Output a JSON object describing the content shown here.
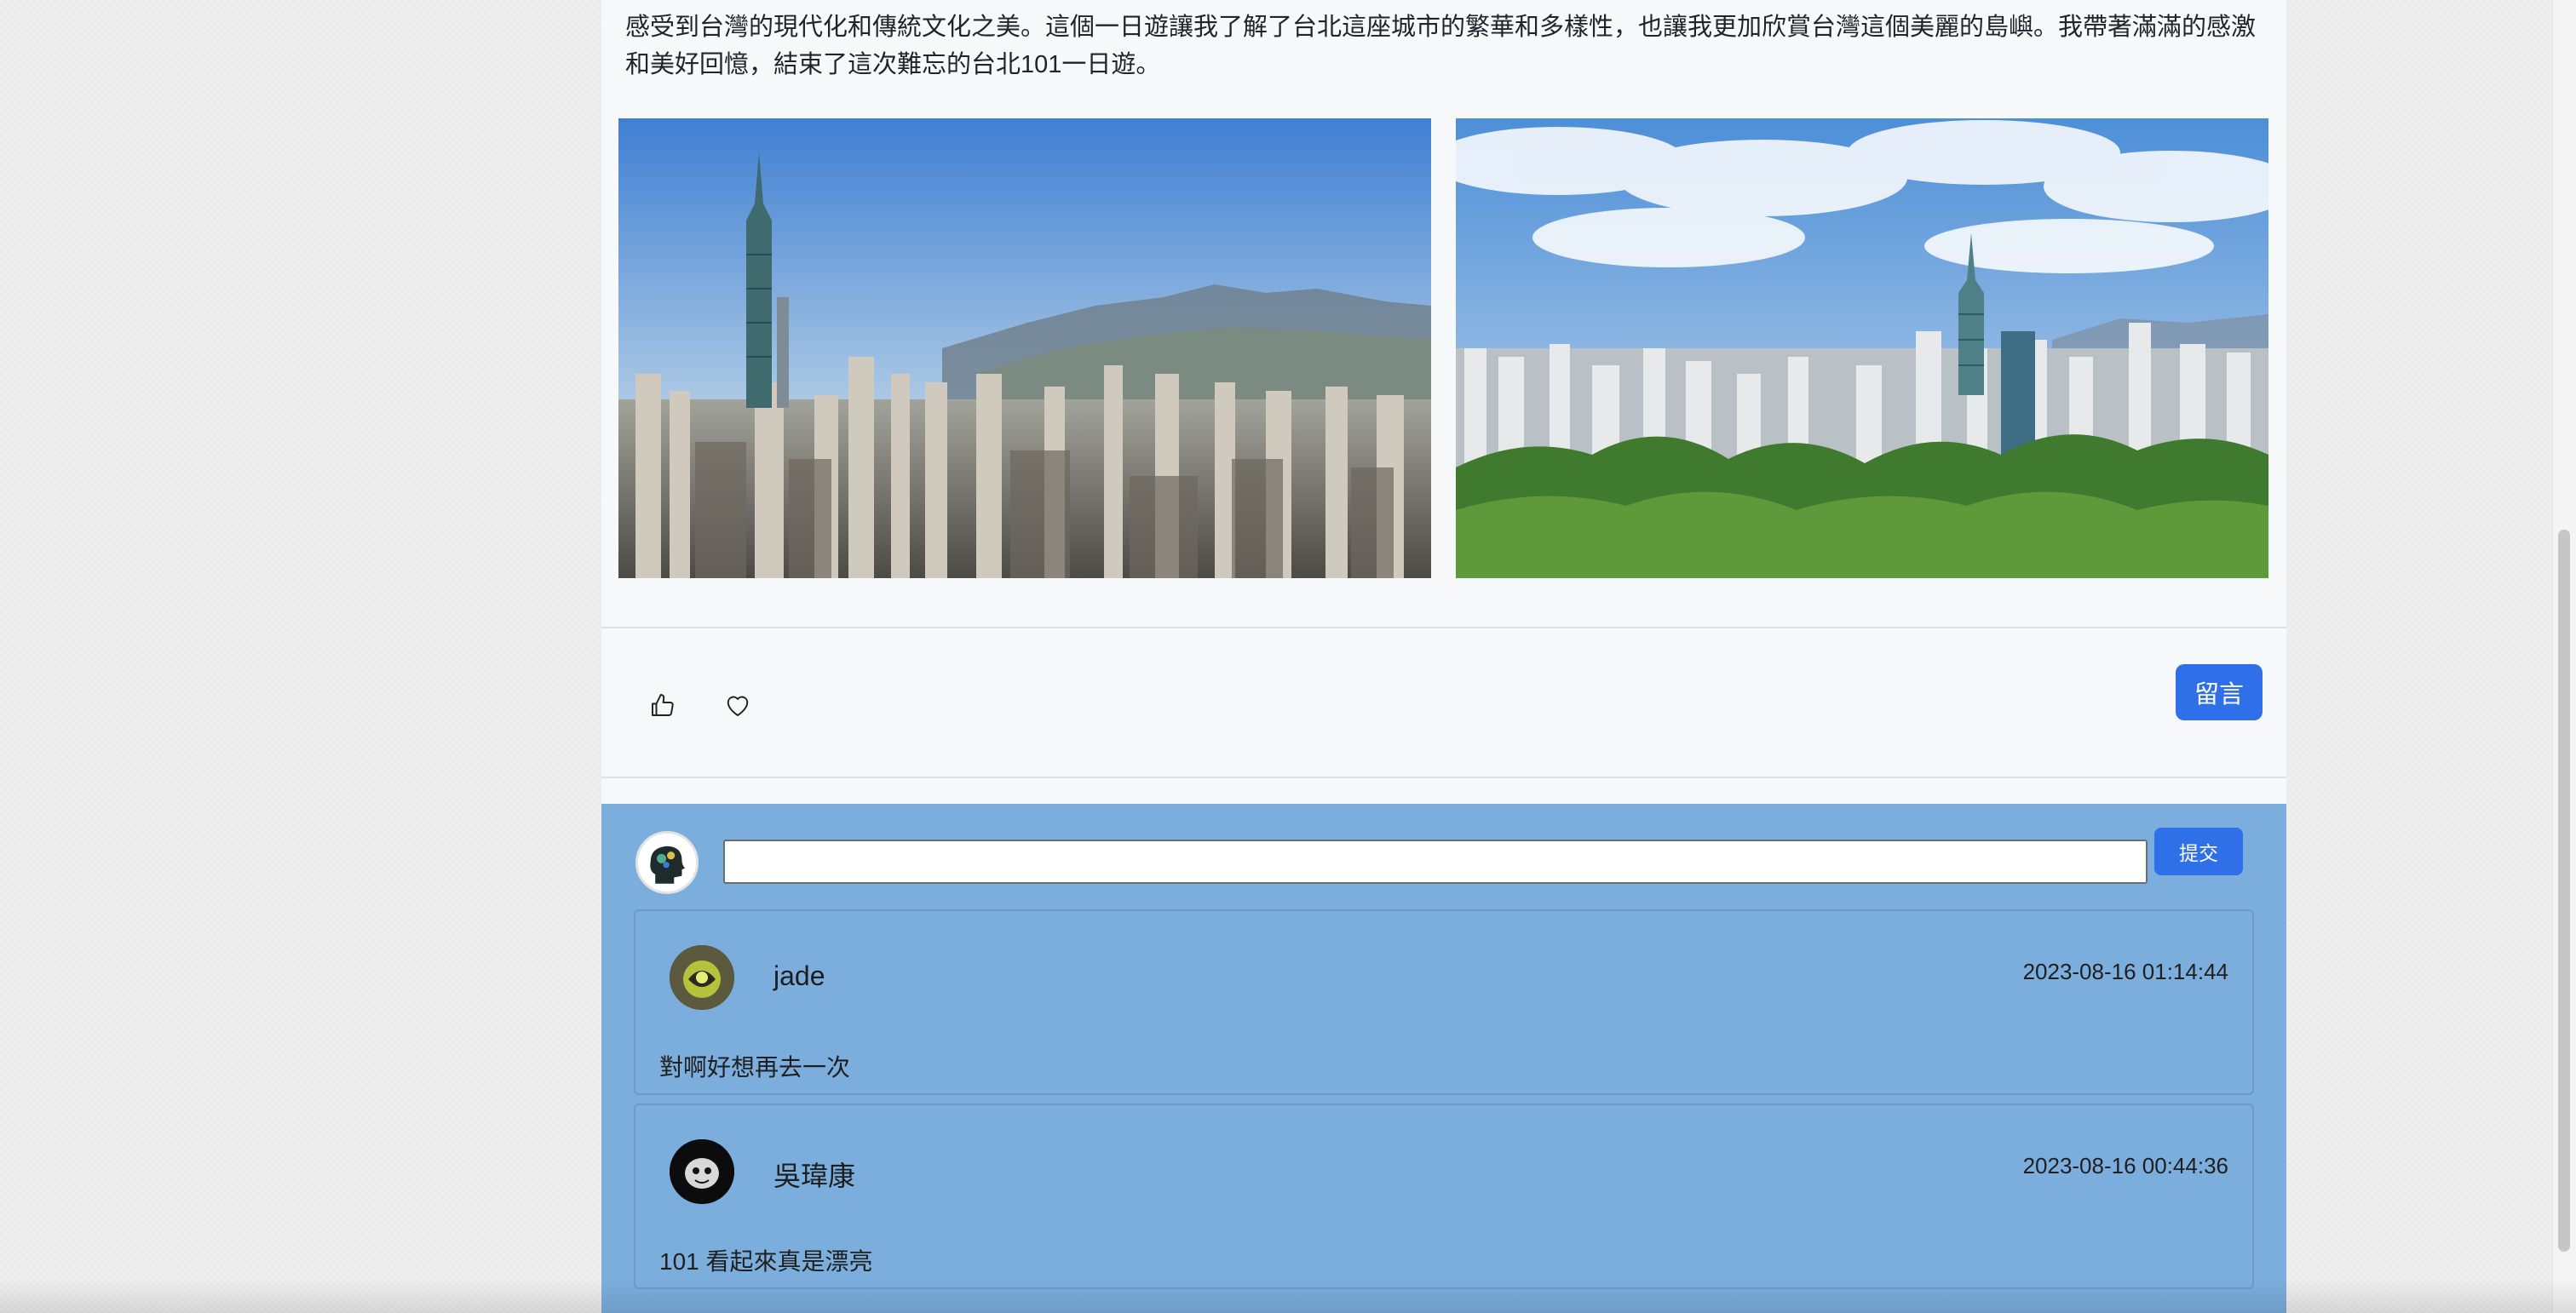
{
  "post": {
    "text": "感受到台灣的現代化和傳統文化之美。這個一日遊讓我了解了台北這座城市的繁華和多樣性，也讓我更加欣賞台灣這個美麗的島嶼。我帶著滿滿的感激和美好回憶，結束了這次難忘的台北101一日遊。",
    "photos": [
      "taipei-101-skyline-mountains",
      "taipei-101-skyline-greenery"
    ]
  },
  "actions": {
    "like_icon": "thumbs-up-icon",
    "favorite_icon": "heart-icon",
    "comment_label": "留言"
  },
  "comment_form": {
    "input_value": "",
    "submit_label": "提交"
  },
  "comments": [
    {
      "author": "jade",
      "timestamp": "2023-08-16 01:14:44",
      "body": "對啊好想再去一次"
    },
    {
      "author": "吳瑋康",
      "timestamp": "2023-08-16 00:44:36",
      "body": "101 看起來真是漂亮"
    }
  ],
  "colors": {
    "accent": "#2f6fe8",
    "comments_bg": "#7caedd",
    "post_bg": "#f7f8fa"
  }
}
